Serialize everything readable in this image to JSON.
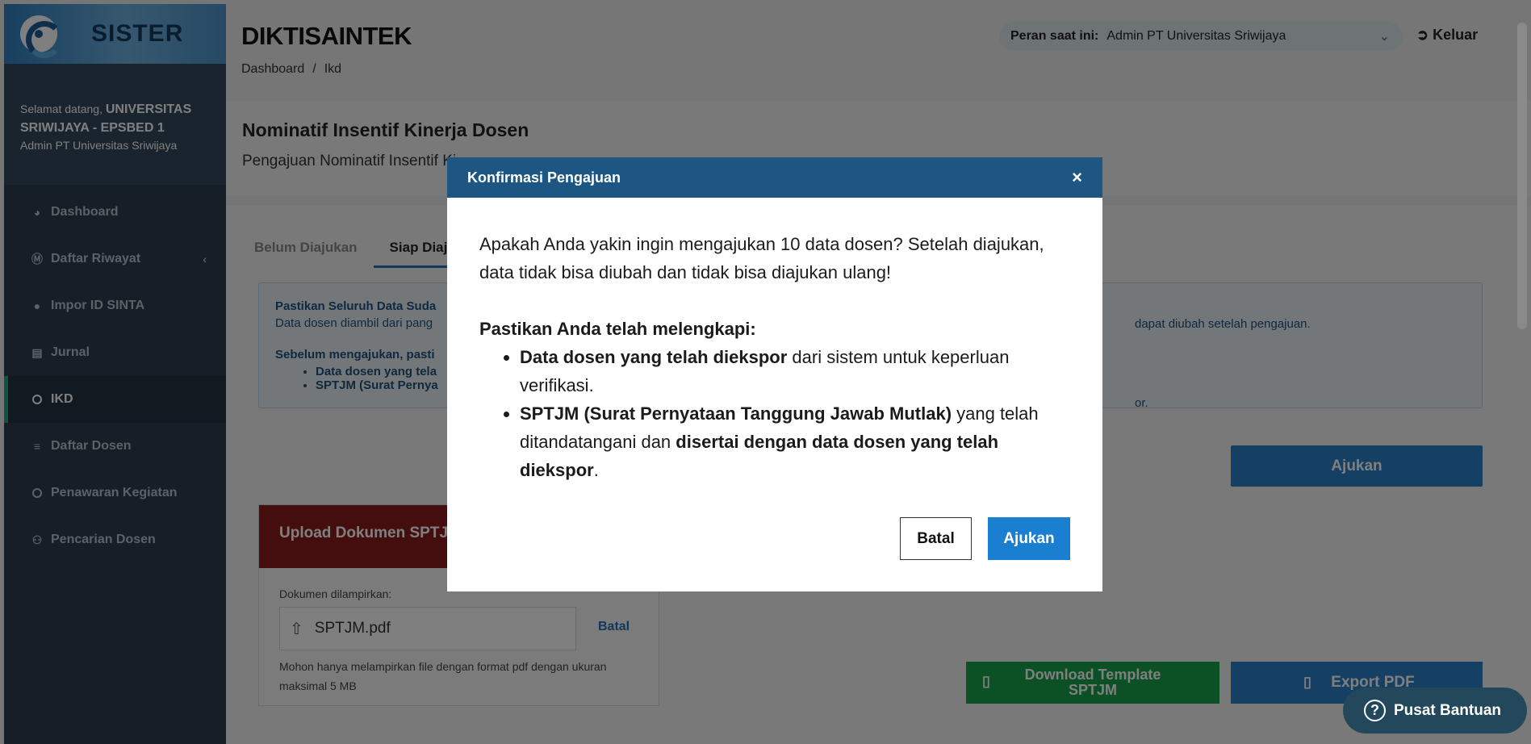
{
  "sidebar": {
    "logo_text": "SISTER",
    "welcome_prefix": "Selamat datang,",
    "welcome_name_1": "UNIVERSITAS",
    "welcome_name_2": "SRIWIJAYA - EPSBED 1",
    "role": "Admin PT Universitas Sriwijaya",
    "items": [
      {
        "label": "Dashboard",
        "icon": "dashboard-icon"
      },
      {
        "label": "Daftar Riwayat",
        "icon": "wordpress-icon"
      },
      {
        "label": "Impor ID SINTA",
        "icon": "cookie-icon"
      },
      {
        "label": "Jurnal",
        "icon": "book-icon"
      },
      {
        "label": "IKD",
        "icon": "circle-icon"
      },
      {
        "label": "Daftar Dosen",
        "icon": "list-icon"
      },
      {
        "label": "Penawaran Kegiatan",
        "icon": "circle-icon"
      },
      {
        "label": "Pencarian Dosen",
        "icon": "users-icon"
      }
    ]
  },
  "header": {
    "brand": "DIKTISAINTEK",
    "breadcrumb": [
      "Dashboard",
      "Ikd"
    ],
    "role_label": "Peran saat ini:",
    "role_value": "Admin PT Universitas Sriwijaya",
    "logout": "Keluar"
  },
  "page": {
    "title": "Nominatif Insentif Kinerja Dosen",
    "subtitle": "Pengajuan Nominatif Insentif Ki"
  },
  "tabs": [
    "Belum Diajukan",
    "Siap Diajuk"
  ],
  "info": {
    "title": "Pastikan Seluruh Data Suda",
    "line1": "Data dosen diambil dari pang",
    "line1_right": "dapat diubah setelah pengajuan.",
    "title2": "Sebelum mengajukan, pasti",
    "bullet1": "Data dosen yang tela",
    "bullet2": "SPTJM (Surat Pernya",
    "bullet2_right": "or."
  },
  "ajukan_main": "Ajukan",
  "upload": {
    "title": "Upload Dokumen SPTJ",
    "attached_label": "Dokumen dilampirkan:",
    "file_name": "SPTJM.pdf",
    "cancel": "Batal",
    "note": "Mohon hanya melampirkan file dengan format pdf dengan ukuran maksimal 5 MB"
  },
  "download_template": "Download Template SPTJM",
  "export_pdf": "Export PDF",
  "modal": {
    "title": "Konfirmasi Pengajuan",
    "close": "×",
    "question": "Apakah Anda yakin ingin mengajukan 10 data dosen? Setelah diajukan, data tidak bisa diubah dan tidak bisa diajukan ulang!",
    "checklist_title": "Pastikan Anda telah melengkapi:",
    "item1_bold": "Data dosen yang telah diekspor",
    "item1_rest": " dari sistem untuk keperluan verifikasi.",
    "item2_bold": "SPTJM (Surat Pernyataan Tanggung Jawab Mutlak)",
    "item2_mid": " yang telah ditandatangani dan ",
    "item2_bold2": "disertai dengan data dosen yang telah diekspor",
    "item2_end": ".",
    "cancel": "Batal",
    "submit": "Ajukan"
  },
  "help": "Pusat Bantuan"
}
